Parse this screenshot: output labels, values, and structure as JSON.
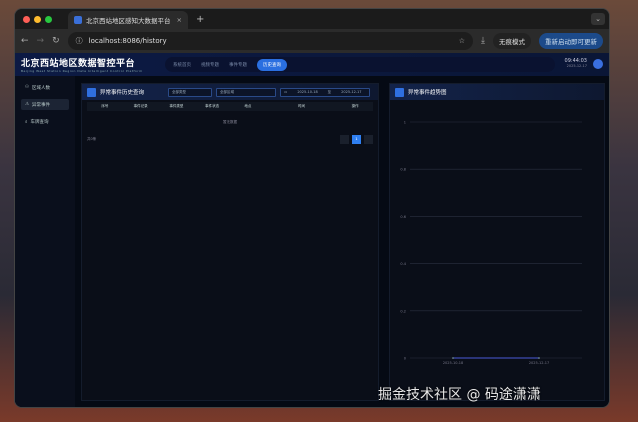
{
  "browser": {
    "tab_title": "北京西站地区感知大数据平台",
    "url": "localhost:8086/history",
    "incognito": "无痕模式",
    "update": "重新启动即可更新"
  },
  "header": {
    "title": "北京西站地区数据智控平台",
    "subtitle": "Beijing West Station Region Data Intelligent Control Platform",
    "time": "09:44:03",
    "date": "2025-12-17",
    "nav": [
      {
        "label": "系统首页"
      },
      {
        "label": "视频专题"
      },
      {
        "label": "事件专题"
      },
      {
        "label": "历史查询"
      }
    ]
  },
  "sidebar": {
    "items": [
      {
        "label": "区域人数"
      },
      {
        "label": "异常事件"
      },
      {
        "label": "车牌查询"
      }
    ]
  },
  "history": {
    "title": "异常事件历史查询",
    "type_select": "全部类型",
    "area_select": "全部区域",
    "date_from": "2025-10-18",
    "date_sep": "至",
    "date_to": "2025-12-17",
    "columns": [
      "序号",
      "事件记录",
      "事件类型",
      "事件状态",
      "地点",
      "时间",
      "操作"
    ],
    "empty": "暂无数据",
    "total": "共0条",
    "page": "1"
  },
  "chart_data": {
    "type": "line",
    "title": "异常事件趋势图",
    "x": [
      "2025-10-18",
      "2025-12-17"
    ],
    "series": [
      {
        "name": "异常事件",
        "values": [
          0,
          0
        ]
      }
    ],
    "yticks": [
      "1",
      "0.8",
      "0.6",
      "0.4",
      "0.2",
      "0"
    ],
    "ylim": [
      0,
      1
    ]
  },
  "watermark": "掘金技术社区 @ 码途潇潇"
}
